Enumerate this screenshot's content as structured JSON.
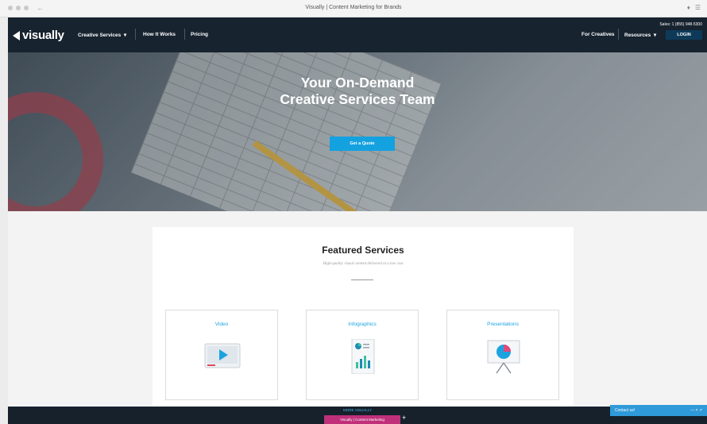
{
  "browser": {
    "title": "Visually | Content Marketing for Brands"
  },
  "nav": {
    "logo": "visually",
    "links": [
      "Creative Services",
      "How It Works",
      "Pricing"
    ],
    "dropdown_glyph": "▾",
    "right_links": [
      "For Creatives",
      "Resources"
    ],
    "sales": "Sales: 1 (855) 948-5300",
    "login": "LOGIN"
  },
  "hero": {
    "title_line1": "Your On-Demand",
    "title_line2": "Creative Services Team",
    "cta": "Get a Quote"
  },
  "featured": {
    "title": "Featured Services",
    "subtitle": "High-quality visual content delivered at a low cost",
    "services": [
      {
        "label": "Video",
        "icon": "video-play-icon"
      },
      {
        "label": "Infographics",
        "icon": "infographic-icon"
      },
      {
        "label": "Presentations",
        "icon": "presentation-easel-icon"
      }
    ]
  },
  "bottom": {
    "more": "MORE VISUALLY",
    "tab": "Visually | Content Marketing",
    "plus": "+",
    "contact": "Contact us!",
    "contact_ctrl": "— × ↗"
  },
  "colors": {
    "nav_bg": "#17232f",
    "accent": "#14a1e0",
    "login_bg": "#0e3a59",
    "tab_pink": "#c0307a"
  }
}
